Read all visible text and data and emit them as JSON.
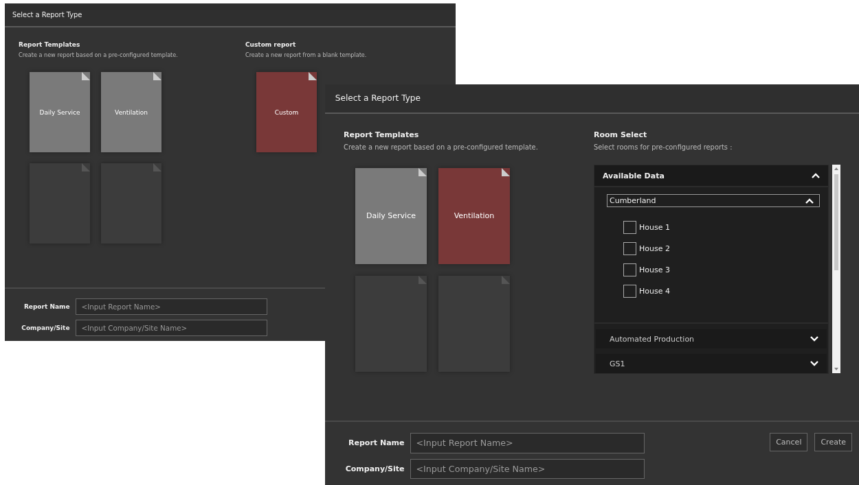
{
  "windows": [
    {
      "title": "Select a Report Type",
      "sections": [
        {
          "kind": "tiles",
          "heading": "Report Templates",
          "description": "Create a new report based on a pre-configured template.",
          "tiles": [
            {
              "label": "Daily Service",
              "selected": false,
              "disabled": false
            },
            {
              "label": "Ventilation",
              "selected": false,
              "disabled": false
            },
            {
              "selected": false,
              "disabled": true
            },
            {
              "selected": false,
              "disabled": true
            }
          ]
        },
        {
          "kind": "tiles",
          "heading": "Custom report",
          "description": "Create a new report from a blank template.",
          "tiles": [
            {
              "label": "Custom",
              "selected": true,
              "disabled": false
            }
          ]
        }
      ],
      "fields": [
        {
          "label": "Report Name",
          "placeholder": "<Input Report Name>"
        },
        {
          "label": "Company/Site",
          "placeholder": "<Input Company/Site Name>"
        }
      ]
    },
    {
      "title": "Select a Report Type",
      "sections": [
        {
          "kind": "tiles",
          "heading": "Report Templates",
          "description": "Create a new report based on a pre-configured template.",
          "tiles": [
            {
              "label": "Daily Service",
              "selected": false,
              "disabled": false
            },
            {
              "label": "Ventilation",
              "selected": true,
              "disabled": false
            },
            {
              "selected": false,
              "disabled": true
            },
            {
              "selected": false,
              "disabled": true
            }
          ]
        },
        {
          "kind": "rooms",
          "heading": "Room Select",
          "description": "Select rooms for pre-configured reports :",
          "tree": {
            "label": "Available Data",
            "expanded": true,
            "children": [
              {
                "label": "Cumberland",
                "expanded": true,
                "children": [
                  {
                    "label": "House 1",
                    "checked": false
                  },
                  {
                    "label": "House 2",
                    "checked": false
                  },
                  {
                    "label": "House 3",
                    "checked": false
                  },
                  {
                    "label": "House 4",
                    "checked": false
                  }
                ]
              },
              {
                "label": "Automated Production",
                "expanded": false
              },
              {
                "label": "GS1",
                "expanded": false
              }
            ]
          }
        }
      ],
      "fields": [
        {
          "label": "Report Name",
          "placeholder": "<Input Report Name>"
        },
        {
          "label": "Company/Site",
          "placeholder": "<Input Company/Site Name>"
        }
      ],
      "buttons": [
        "Cancel",
        "Create"
      ]
    }
  ]
}
